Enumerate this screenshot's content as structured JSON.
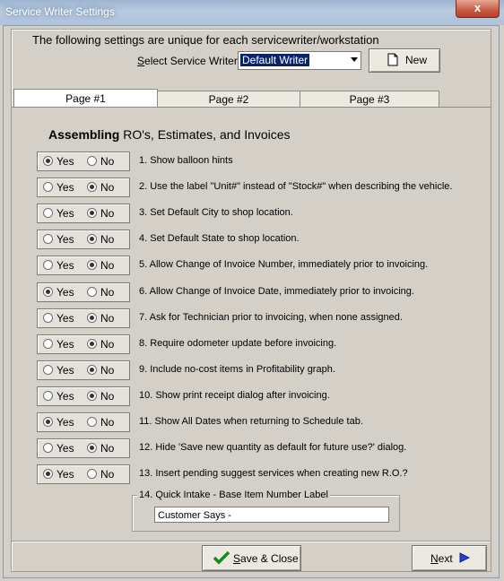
{
  "window": {
    "title": "Service Writer Settings",
    "close_label": "x"
  },
  "header": {
    "info": "The following settings are unique for each servicewriter/workstation",
    "select_label_prefix": "S",
    "select_label_rest": "elect Service Writer",
    "select_value": "Default Writer",
    "new_label": "New"
  },
  "tabs": [
    "Page #1",
    "Page #2",
    "Page #3"
  ],
  "section": {
    "bold": "Assembling",
    "rest": " RO's, Estimates, and Invoices"
  },
  "radio_labels": {
    "yes": "Yes",
    "no": "No"
  },
  "settings": [
    {
      "text": "1. Show balloon hints",
      "value": "Yes"
    },
    {
      "text": "2. Use the label \"Unit#\" instead of \"Stock#\" when describing the vehicle.",
      "value": "No"
    },
    {
      "text": "3. Set Default City to shop location.",
      "value": "No"
    },
    {
      "text": "4. Set Default State to shop location.",
      "value": "No"
    },
    {
      "text": "5. Allow Change of Invoice Number, immediately prior to invoicing.",
      "value": "No"
    },
    {
      "text": "6. Allow Change of Invoice Date, immediately prior to invoicing.",
      "value": "Yes"
    },
    {
      "text": "7. Ask for Technician prior to invoicing,  when none assigned.",
      "value": "No"
    },
    {
      "text": " 8. Require odometer update before invoicing.",
      "value": "No"
    },
    {
      "text": "9. Include no-cost items in Profitability graph.",
      "value": "No"
    },
    {
      "text": "10. Show print receipt dialog after invoicing.",
      "value": "No"
    },
    {
      "text": "11. Show All Dates when returning to Schedule tab.",
      "value": "Yes"
    },
    {
      "text": "12. Hide 'Save new quantity as default for future use?' dialog.",
      "value": "No"
    },
    {
      "text": "13. Insert pending suggest services when creating new R.O.?",
      "value": "Yes"
    }
  ],
  "intake": {
    "legend": "14. Quick Intake - Base Item Number Label",
    "value": "Customer Says -"
  },
  "footer": {
    "save_prefix": "S",
    "save_rest": "ave & Close",
    "next_prefix": "N",
    "next_rest": "ext"
  },
  "colors": {
    "accent": "#0a246a",
    "face": "#d4d0c8"
  }
}
